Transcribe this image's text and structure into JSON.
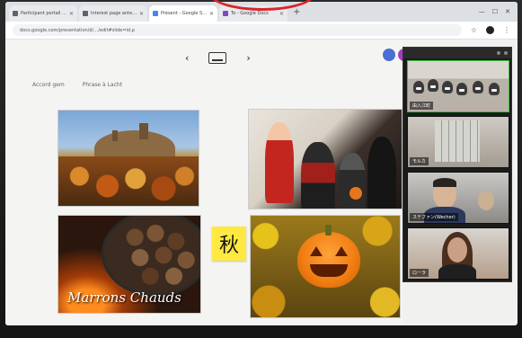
{
  "browser": {
    "tabs": [
      {
        "title": "Participant portail de repond",
        "active": false
      },
      {
        "title": "Interest page anterior",
        "active": false
      },
      {
        "title": "Présent - Google Slides",
        "active": true
      },
      {
        "title": "To - Google Docs",
        "active": false
      }
    ],
    "url": "docs.google.com/presentation/d/…/edit#slide=id.p"
  },
  "slides": {
    "menu": [
      "Accord gem",
      "Phrase à Lacht"
    ],
    "kanji": "秋",
    "chestnut_caption": "Marrons Chauds"
  },
  "zoom": {
    "participants": [
      {
        "name": "由入江町"
      },
      {
        "name": "モルカ"
      },
      {
        "name": "ステファン(Wecher)"
      },
      {
        "name": "ローラ"
      }
    ]
  }
}
